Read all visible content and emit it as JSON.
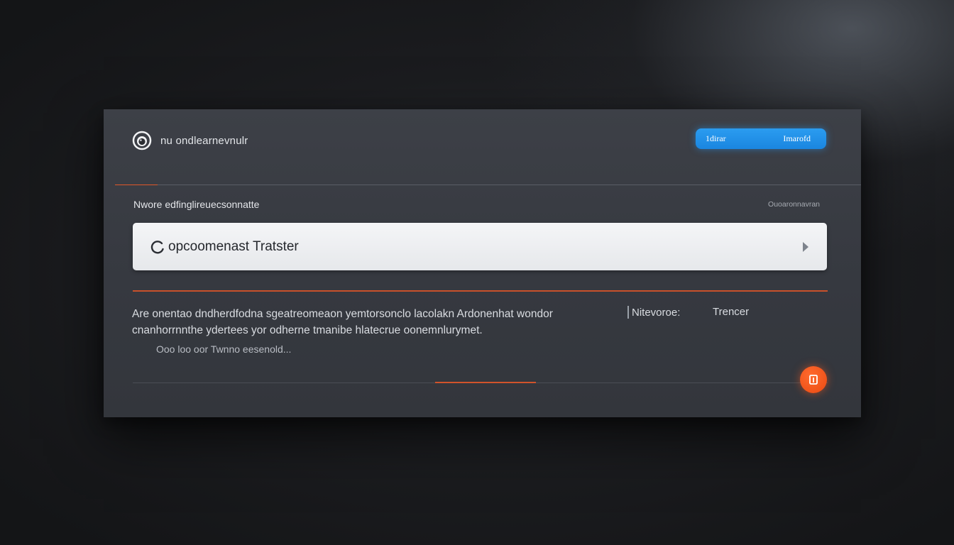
{
  "header": {
    "title": "nu ondlearnevnulr",
    "button": {
      "left_label": "1dirar",
      "right_label": "Imarofd"
    }
  },
  "section": {
    "label": "Nwore edfinglireuecsonnatte",
    "meta": "Ouoaronnavran"
  },
  "selector": {
    "value": "opcoomenast Tratster",
    "icon": "loading-circle-icon",
    "arrow_icon": "chevron-right-icon"
  },
  "description": {
    "line1": "Are onentao dndherdfodna sgeatreomeaon yemtorsonclo lacolakn Ardonenhat wondor",
    "line2": "cnanhorrnnthe ydertees yor odherne tmanibe hlatecrue oonemnlurymet.",
    "sub": "Ooo loo oor Twnno eesenold..."
  },
  "options": {
    "a": "Nitevoroe:",
    "b": "Trencer"
  },
  "fab": {
    "icon": "info-icon"
  },
  "colors": {
    "accent_orange": "#e0572a",
    "button_blue": "#1a86e0",
    "panel_bg": "#3a3d44"
  }
}
